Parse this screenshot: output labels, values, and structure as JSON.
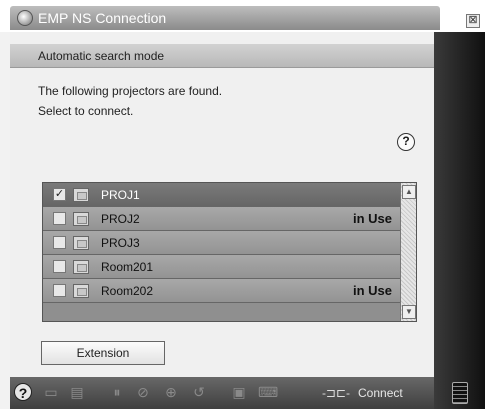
{
  "window": {
    "title": "EMP NS Connection",
    "close_glyph": "⊠"
  },
  "mode_bar": {
    "label": "Automatic search mode"
  },
  "message": {
    "line1": "The following projectors are found.",
    "line2": "Select to connect."
  },
  "help_glyph": "?",
  "projectors": [
    {
      "name": "PROJ1",
      "checked": true,
      "status": "",
      "selected": true
    },
    {
      "name": "PROJ2",
      "checked": false,
      "status": "in Use",
      "selected": false
    },
    {
      "name": "PROJ3",
      "checked": false,
      "status": "",
      "selected": false
    },
    {
      "name": "Room201",
      "checked": false,
      "status": "",
      "selected": false
    },
    {
      "name": "Room202",
      "checked": false,
      "status": "in Use",
      "selected": false
    }
  ],
  "extension_button": {
    "label": "Extension"
  },
  "toolbar": {
    "icons": [
      "help-icon",
      "display-icon",
      "document-icon",
      "pause-icon",
      "freeze-icon",
      "zoom-icon",
      "rotate-icon",
      "av-mute-icon",
      "keyboard-icon"
    ],
    "connect_label": "Connect",
    "connect_glyph": "-⊐⊏-"
  },
  "colors": {
    "selected_row": "#6e6e6e",
    "row": "#9d9d9d",
    "toolbar": "#505050"
  }
}
